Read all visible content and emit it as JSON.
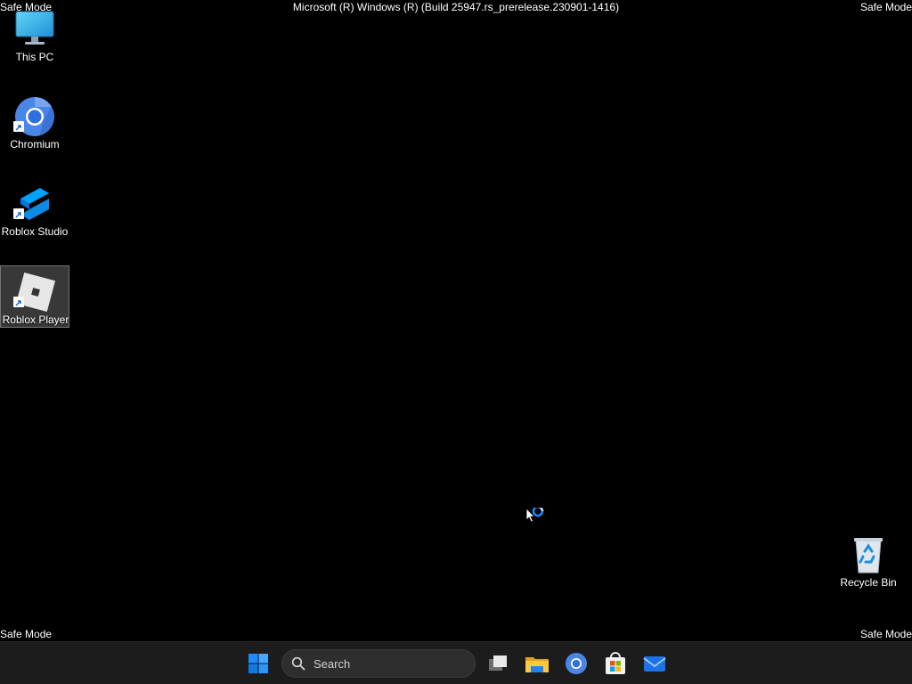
{
  "watermark": {
    "safe_mode_label": "Safe Mode",
    "build_text": "Microsoft (R) Windows (R) (Build 25947.rs_prerelease.230901-1416)"
  },
  "desktop_icons": [
    {
      "label": "This PC",
      "icon": "monitor-icon"
    },
    {
      "label": "Chromium",
      "icon": "chromium-icon",
      "shortcut": true
    },
    {
      "label": "Roblox Studio",
      "icon": "roblox-studio-icon",
      "shortcut": true
    },
    {
      "label": "Roblox Player",
      "icon": "roblox-player-icon",
      "shortcut": true,
      "selected": true
    },
    {
      "label": "Recycle Bin",
      "icon": "recycle-bin-icon"
    }
  ],
  "taskbar": {
    "search_placeholder": "Search",
    "pinned": [
      "start-icon",
      "task-view-icon",
      "file-explorer-icon",
      "chromium-icon",
      "microsoft-store-icon",
      "mail-icon"
    ]
  },
  "colors": {
    "desktop_background": "#000000",
    "taskbar_background": "#1c1c1c",
    "accent": "#1a8cff"
  }
}
